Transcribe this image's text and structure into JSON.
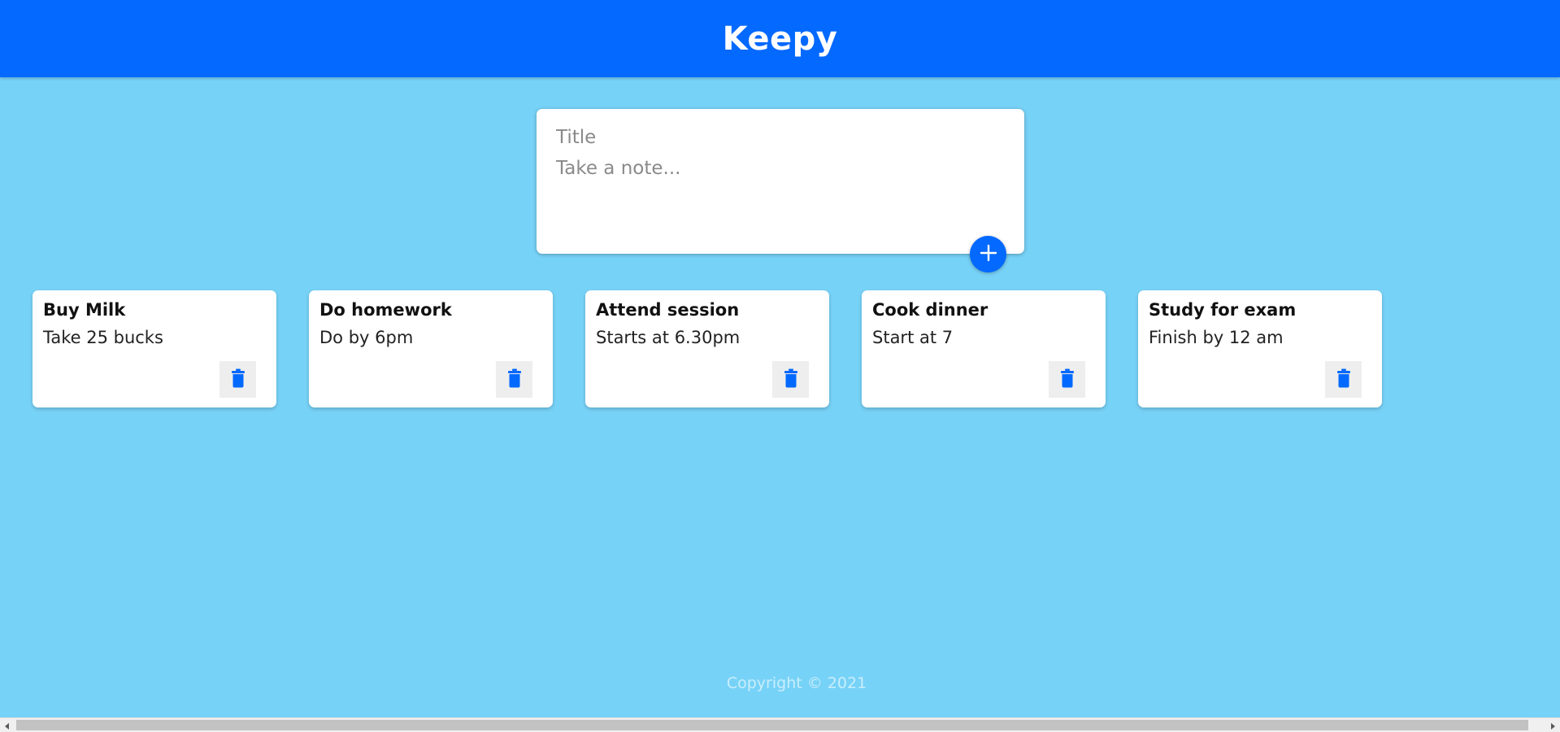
{
  "header": {
    "title": "Keepy"
  },
  "create_note": {
    "title_placeholder": "Title",
    "content_placeholder": "Take a note...",
    "add_icon": "plus-icon"
  },
  "notes": [
    {
      "title": "Buy Milk",
      "content": "Take 25 bucks",
      "delete_icon": "trash-icon"
    },
    {
      "title": "Do homework",
      "content": "Do by 6pm",
      "delete_icon": "trash-icon"
    },
    {
      "title": "Attend session",
      "content": "Starts at 6.30pm",
      "delete_icon": "trash-icon"
    },
    {
      "title": "Cook dinner",
      "content": "Start at 7",
      "delete_icon": "trash-icon"
    },
    {
      "title": "Study for exam",
      "content": "Finish by 12 am",
      "delete_icon": "trash-icon"
    }
  ],
  "footer": {
    "copyright": "Copyright © 2021"
  },
  "colors": {
    "header_bg": "#0369ff",
    "page_bg": "#77d2f7",
    "card_bg": "#ffffff",
    "accent": "#0369ff",
    "footer_text": "#c8eefc"
  }
}
